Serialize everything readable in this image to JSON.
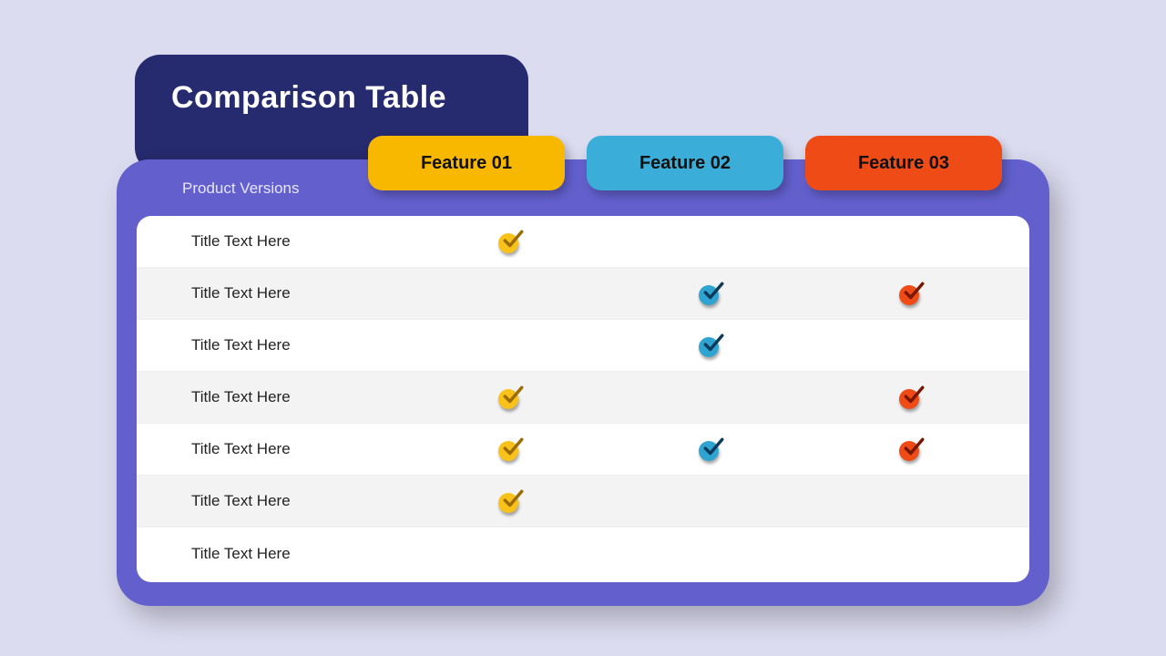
{
  "title": "Comparison Table",
  "subheader": "Product Versions",
  "features": [
    "Feature 01",
    "Feature 02",
    "Feature 03"
  ],
  "colors": {
    "f1": "#f8b800",
    "f2": "#3aaed8",
    "f3": "#ee4b17"
  },
  "rows": [
    {
      "label": "Title Text Here",
      "checks": [
        true,
        false,
        false
      ]
    },
    {
      "label": "Title Text Here",
      "checks": [
        false,
        true,
        true
      ]
    },
    {
      "label": "Title Text Here",
      "checks": [
        false,
        true,
        false
      ]
    },
    {
      "label": "Title Text Here",
      "checks": [
        true,
        false,
        true
      ]
    },
    {
      "label": "Title Text Here",
      "checks": [
        true,
        true,
        true
      ]
    },
    {
      "label": "Title Text Here",
      "checks": [
        true,
        false,
        false
      ]
    },
    {
      "label": "Title Text Here",
      "checks": [
        false,
        false,
        false
      ]
    }
  ]
}
